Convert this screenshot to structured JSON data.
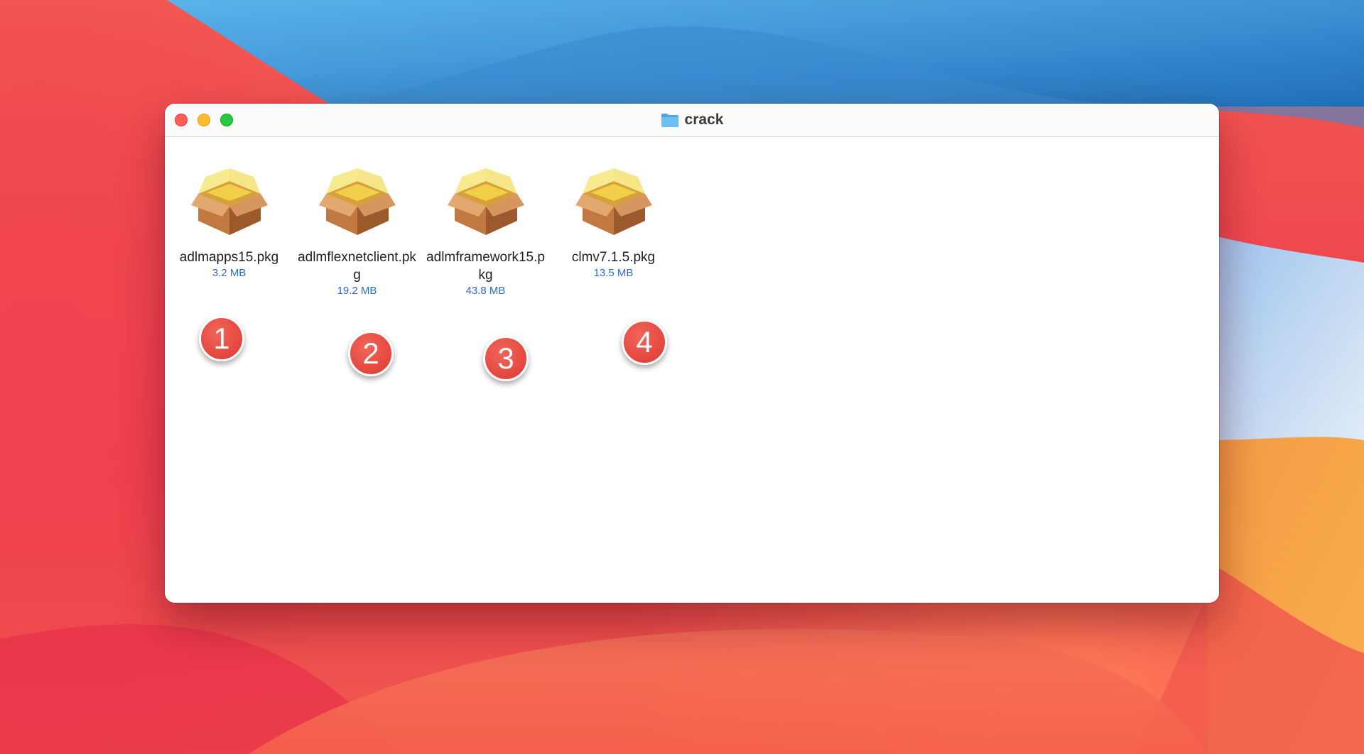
{
  "desktop": {
    "wallpaper_colors": [
      "#ec3b4d",
      "#3a8fd4",
      "#f7a24a",
      "#b9d4f2"
    ]
  },
  "window": {
    "title": "crack",
    "title_icon": "folder-icon",
    "traffic_lights": {
      "close": "#fe5f57",
      "minimize": "#febc2e",
      "zoom": "#28c840"
    }
  },
  "files": [
    {
      "name": "adlmapps15.pkg",
      "size": "3.2 MB",
      "icon": "package-icon"
    },
    {
      "name": "adlmflexnetclient.pkg",
      "size": "19.2 MB",
      "icon": "package-icon"
    },
    {
      "name": "adlmframework15.pkg",
      "size": "43.8 MB",
      "icon": "package-icon"
    },
    {
      "name": "clmv7.1.5.pkg",
      "size": "13.5 MB",
      "icon": "package-icon"
    }
  ],
  "badges": [
    {
      "label": "1",
      "color": "#e4463d"
    },
    {
      "label": "2",
      "color": "#e4463d"
    },
    {
      "label": "3",
      "color": "#e4463d"
    },
    {
      "label": "4",
      "color": "#e4463d"
    }
  ]
}
